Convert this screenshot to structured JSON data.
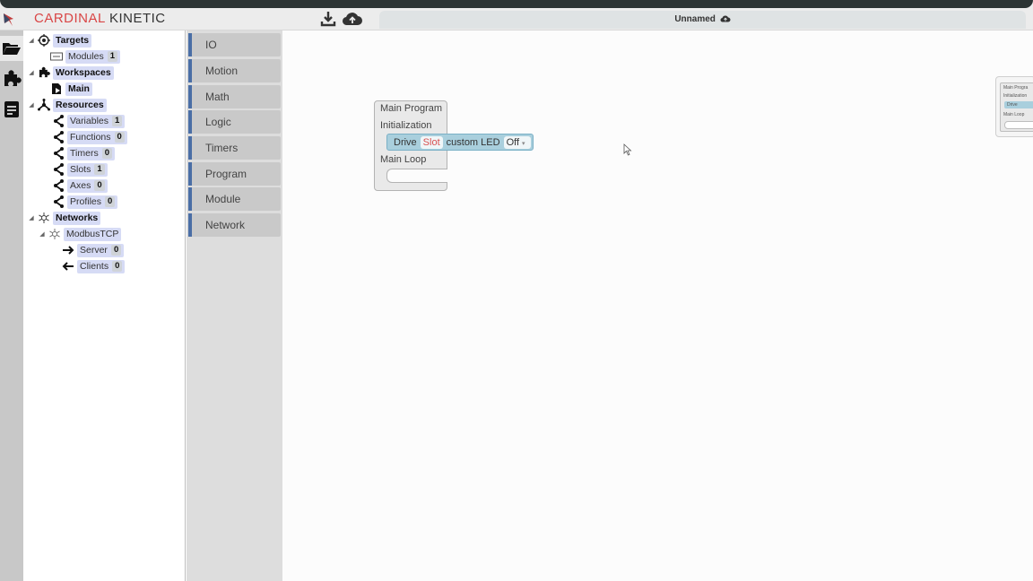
{
  "header": {
    "brand_part1": "CARDINAL",
    "brand_part2": "KINETIC",
    "document_title": "Unnamed",
    "accent_color": "#d94545"
  },
  "iconbar": {
    "items": [
      {
        "name": "folder-open-icon"
      },
      {
        "name": "puzzle-icon"
      },
      {
        "name": "document-icon"
      }
    ]
  },
  "tree": {
    "targets": {
      "label": "Targets"
    },
    "modules": {
      "label": "Modules",
      "count": "1"
    },
    "workspaces": {
      "label": "Workspaces"
    },
    "main": {
      "label": "Main"
    },
    "resources": {
      "label": "Resources"
    },
    "variables": {
      "label": "Variables",
      "count": "1"
    },
    "functions": {
      "label": "Functions",
      "count": "0"
    },
    "timers": {
      "label": "Timers",
      "count": "0"
    },
    "slots": {
      "label": "Slots",
      "count": "1"
    },
    "axes": {
      "label": "Axes",
      "count": "0"
    },
    "profiles": {
      "label": "Profiles",
      "count": "0"
    },
    "networks": {
      "label": "Networks"
    },
    "modbustcp": {
      "label": "ModbusTCP"
    },
    "server": {
      "label": "Server",
      "count": "0"
    },
    "clients": {
      "label": "Clients",
      "count": "0"
    }
  },
  "palette": {
    "categories": [
      "IO",
      "Motion",
      "Math",
      "Logic",
      "Timers",
      "Program",
      "Module",
      "Network"
    ],
    "accent_color": "#4a6ea5"
  },
  "workspace": {
    "main_program": {
      "title": "Main Program",
      "init_label": "Initialization",
      "loop_label": "Main Loop"
    },
    "drive_block": {
      "prefix": "Drive",
      "slot": "Slot",
      "device": "custom LED",
      "state": "Off"
    },
    "minimap": {
      "title": "Main Progra",
      "init": "Initialization",
      "drive": "Drive",
      "loop": "Main Loop"
    }
  }
}
